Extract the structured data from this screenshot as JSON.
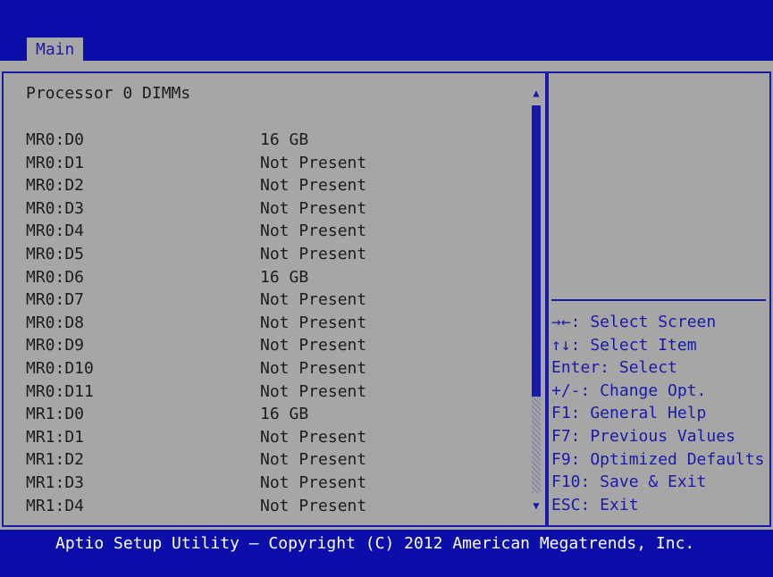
{
  "tabs": [
    {
      "label": "Main"
    }
  ],
  "main": {
    "section_title": "Processor 0 DIMMs",
    "rows": [
      {
        "label": "MR0:D0",
        "value": "16 GB"
      },
      {
        "label": "MR0:D1",
        "value": "Not Present"
      },
      {
        "label": "MR0:D2",
        "value": "Not Present"
      },
      {
        "label": "MR0:D3",
        "value": "Not Present"
      },
      {
        "label": "MR0:D4",
        "value": "Not Present"
      },
      {
        "label": "MR0:D5",
        "value": "Not Present"
      },
      {
        "label": "MR0:D6",
        "value": "16 GB"
      },
      {
        "label": "MR0:D7",
        "value": "Not Present"
      },
      {
        "label": "MR0:D8",
        "value": "Not Present"
      },
      {
        "label": "MR0:D9",
        "value": "Not Present"
      },
      {
        "label": "MR0:D10",
        "value": "Not Present"
      },
      {
        "label": "MR0:D11",
        "value": "Not Present"
      },
      {
        "label": "MR1:D0",
        "value": "16 GB"
      },
      {
        "label": "MR1:D1",
        "value": "Not Present"
      },
      {
        "label": "MR1:D2",
        "value": "Not Present"
      },
      {
        "label": "MR1:D3",
        "value": "Not Present"
      },
      {
        "label": "MR1:D4",
        "value": "Not Present"
      }
    ]
  },
  "scrollbar": {
    "up_icon": "▲",
    "down_icon": "▼"
  },
  "help": [
    {
      "text": "→←: Select Screen"
    },
    {
      "text": "↑↓: Select Item"
    },
    {
      "text": "Enter: Select"
    },
    {
      "text": "+/-: Change Opt."
    },
    {
      "text": "F1: General Help"
    },
    {
      "text": "F7: Previous Values"
    },
    {
      "text": "F9: Optimized Defaults"
    },
    {
      "text": "F10: Save & Exit"
    },
    {
      "text": "ESC: Exit"
    }
  ],
  "footer": {
    "text": "Aptio Setup Utility – Copyright (C) 2012 American Megatrends, Inc."
  },
  "colors": {
    "background": "#0b0ea8",
    "panel": "#a6a6a6",
    "accent": "#1a1aa8",
    "text": "#1c1c1c"
  }
}
